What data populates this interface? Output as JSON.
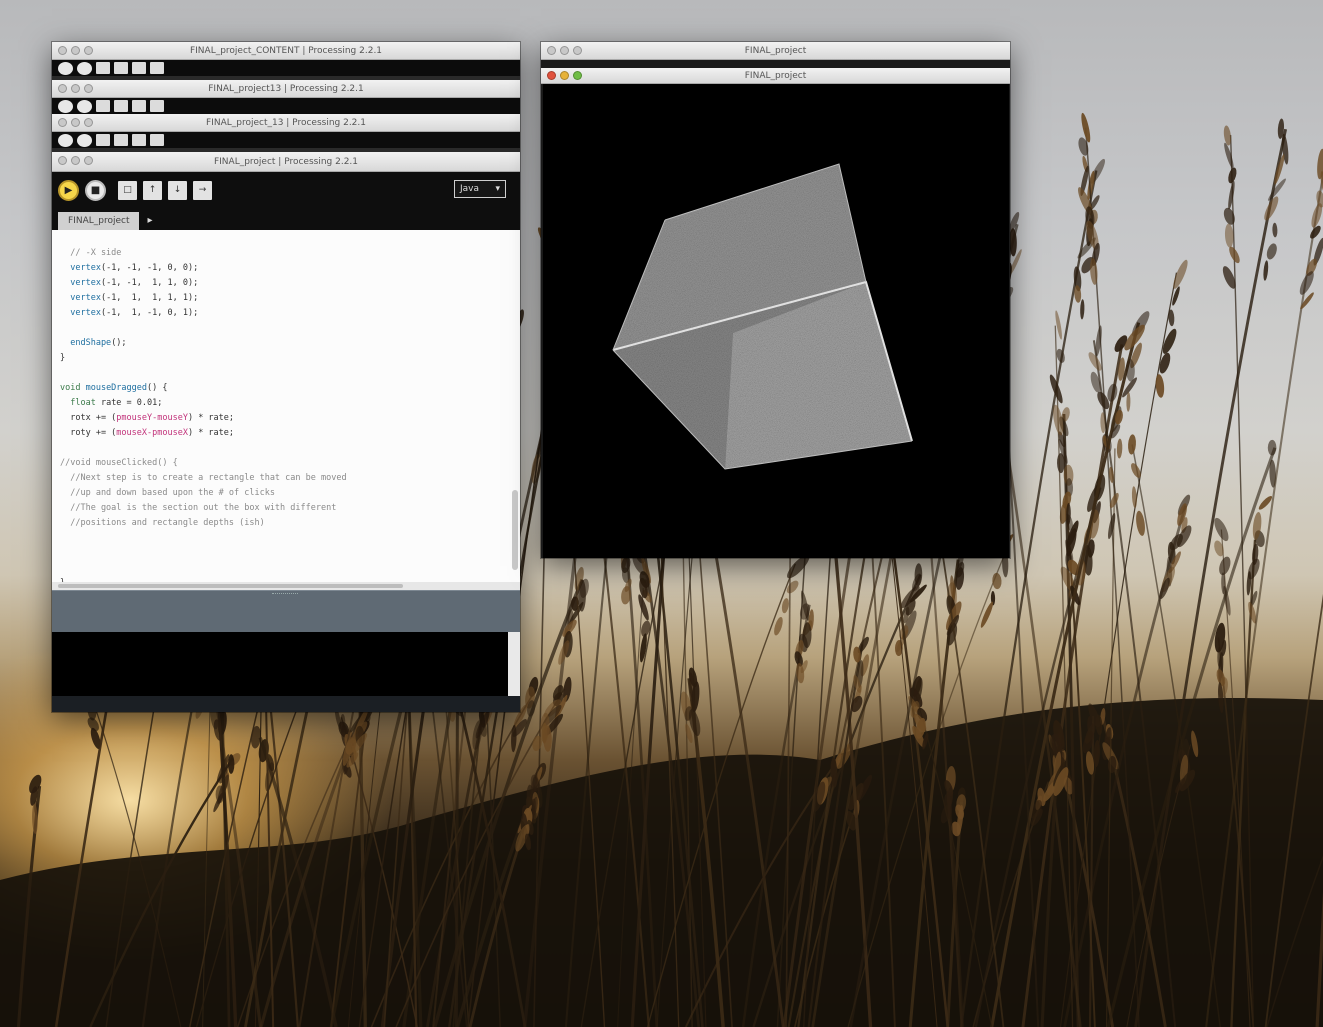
{
  "windows": {
    "editor_stack": [
      {
        "title": "FINAL_project_CONTENT | Processing 2.2.1"
      },
      {
        "title": "FINAL_project13 | Processing 2.2.1"
      },
      {
        "title": "FINAL_project_13 | Processing 2.2.1"
      }
    ],
    "editor": {
      "title": "FINAL_project | Processing 2.2.1",
      "toolbar": {
        "run_icon": "play-icon",
        "stop_icon": "stop-icon",
        "new_icon": "new-file-icon",
        "open_icon": "open-icon",
        "save_icon": "save-icon",
        "export_icon": "export-icon",
        "mode_label": "Java",
        "mode_arrow": "▾"
      },
      "tabs": {
        "active": "FINAL_project",
        "arrow": "▸"
      },
      "code": [
        [
          {
            "t": "  // -X side",
            "c": "comment"
          }
        ],
        [
          {
            "t": "  vertex",
            "c": "func"
          },
          {
            "t": "(-1, -1, -1, 0, 0);",
            "c": "plain"
          }
        ],
        [
          {
            "t": "  vertex",
            "c": "func"
          },
          {
            "t": "(-1, -1,  1, 1, 0);",
            "c": "plain"
          }
        ],
        [
          {
            "t": "  vertex",
            "c": "func"
          },
          {
            "t": "(-1,  1,  1, 1, 1);",
            "c": "plain"
          }
        ],
        [
          {
            "t": "  vertex",
            "c": "func"
          },
          {
            "t": "(-1,  1, -1, 0, 1);",
            "c": "plain"
          }
        ],
        [
          {
            "t": "",
            "c": "plain"
          }
        ],
        [
          {
            "t": "  endShape",
            "c": "func"
          },
          {
            "t": "();",
            "c": "plain"
          }
        ],
        [
          {
            "t": "}",
            "c": "plain"
          }
        ],
        [
          {
            "t": "",
            "c": "plain"
          }
        ],
        [
          {
            "t": "void ",
            "c": "kw"
          },
          {
            "t": "mouseDragged",
            "c": "func"
          },
          {
            "t": "() {",
            "c": "plain"
          }
        ],
        [
          {
            "t": "  float ",
            "c": "kw"
          },
          {
            "t": "rate = 0.01;",
            "c": "plain"
          }
        ],
        [
          {
            "t": "  rotx += (",
            "c": "plain"
          },
          {
            "t": "pmouseY-mouseY",
            "c": "sys"
          },
          {
            "t": ") * rate;",
            "c": "plain"
          }
        ],
        [
          {
            "t": "  roty += (",
            "c": "plain"
          },
          {
            "t": "mouseX-pmouseX",
            "c": "sys"
          },
          {
            "t": ") * rate;",
            "c": "plain"
          }
        ],
        [
          {
            "t": "",
            "c": "plain"
          }
        ],
        [
          {
            "t": "//void ",
            "c": "comment"
          },
          {
            "t": "mouseClicked() {",
            "c": "comment"
          }
        ],
        [
          {
            "t": "  //Next step is to create a rectangle that can be moved",
            "c": "comment"
          }
        ],
        [
          {
            "t": "  //up and down based upon the # of clicks",
            "c": "comment"
          }
        ],
        [
          {
            "t": "  //The goal is the section out the box with different",
            "c": "comment"
          }
        ],
        [
          {
            "t": "  //positions and rectangle depths (ish)",
            "c": "comment"
          }
        ],
        [
          {
            "t": "",
            "c": "plain"
          }
        ],
        [
          {
            "t": "",
            "c": "plain"
          }
        ],
        [
          {
            "t": "",
            "c": "plain"
          }
        ],
        [
          {
            "t": "}",
            "c": "plain"
          }
        ]
      ]
    },
    "sketch": {
      "back_title": "FINAL_project",
      "front_title": "FINAL_project"
    }
  },
  "colors": {
    "run_button": "#f6d64a",
    "canvas": "#000000",
    "console": "#000000",
    "message_bar": "#5f6a74"
  }
}
